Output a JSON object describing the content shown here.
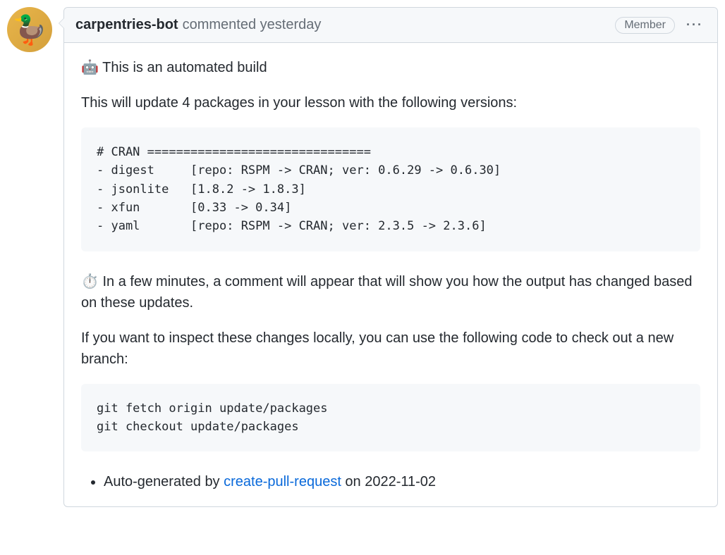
{
  "comment": {
    "author": "carpentries-bot",
    "action": "commented",
    "timestamp": "yesterday",
    "badge": "Member",
    "body": {
      "line1": "🤖 This is an automated build",
      "line2": "This will update 4 packages in your lesson with the following versions:",
      "code1": "# CRAN ===============================\n- digest     [repo: RSPM -> CRAN; ver: 0.6.29 -> 0.6.30]\n- jsonlite   [1.8.2 -> 1.8.3]\n- xfun       [0.33 -> 0.34]\n- yaml       [repo: RSPM -> CRAN; ver: 2.3.5 -> 2.3.6]\n",
      "line3": "⏱️ In a few minutes, a comment will appear that will show you how the output has changed based on these updates.",
      "line4": "If you want to inspect these changes locally, you can use the following code to check out a new branch:",
      "code2": "git fetch origin update/packages\ngit checkout update/packages",
      "footer_prefix": "Auto-generated by ",
      "footer_link": "create-pull-request",
      "footer_suffix": " on 2022-11-02"
    }
  }
}
